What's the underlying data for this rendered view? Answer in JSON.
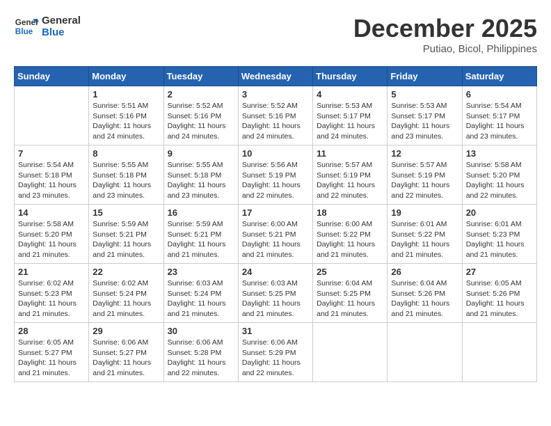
{
  "header": {
    "logo_general": "General",
    "logo_blue": "Blue",
    "month": "December 2025",
    "location": "Putiao, Bicol, Philippines"
  },
  "weekdays": [
    "Sunday",
    "Monday",
    "Tuesday",
    "Wednesday",
    "Thursday",
    "Friday",
    "Saturday"
  ],
  "weeks": [
    [
      {
        "day": "",
        "info": ""
      },
      {
        "day": "1",
        "info": "Sunrise: 5:51 AM\nSunset: 5:16 PM\nDaylight: 11 hours\nand 24 minutes."
      },
      {
        "day": "2",
        "info": "Sunrise: 5:52 AM\nSunset: 5:16 PM\nDaylight: 11 hours\nand 24 minutes."
      },
      {
        "day": "3",
        "info": "Sunrise: 5:52 AM\nSunset: 5:16 PM\nDaylight: 11 hours\nand 24 minutes."
      },
      {
        "day": "4",
        "info": "Sunrise: 5:53 AM\nSunset: 5:17 PM\nDaylight: 11 hours\nand 24 minutes."
      },
      {
        "day": "5",
        "info": "Sunrise: 5:53 AM\nSunset: 5:17 PM\nDaylight: 11 hours\nand 23 minutes."
      },
      {
        "day": "6",
        "info": "Sunrise: 5:54 AM\nSunset: 5:17 PM\nDaylight: 11 hours\nand 23 minutes."
      }
    ],
    [
      {
        "day": "7",
        "info": "Sunrise: 5:54 AM\nSunset: 5:18 PM\nDaylight: 11 hours\nand 23 minutes."
      },
      {
        "day": "8",
        "info": "Sunrise: 5:55 AM\nSunset: 5:18 PM\nDaylight: 11 hours\nand 23 minutes."
      },
      {
        "day": "9",
        "info": "Sunrise: 5:55 AM\nSunset: 5:18 PM\nDaylight: 11 hours\nand 23 minutes."
      },
      {
        "day": "10",
        "info": "Sunrise: 5:56 AM\nSunset: 5:19 PM\nDaylight: 11 hours\nand 22 minutes."
      },
      {
        "day": "11",
        "info": "Sunrise: 5:57 AM\nSunset: 5:19 PM\nDaylight: 11 hours\nand 22 minutes."
      },
      {
        "day": "12",
        "info": "Sunrise: 5:57 AM\nSunset: 5:19 PM\nDaylight: 11 hours\nand 22 minutes."
      },
      {
        "day": "13",
        "info": "Sunrise: 5:58 AM\nSunset: 5:20 PM\nDaylight: 11 hours\nand 22 minutes."
      }
    ],
    [
      {
        "day": "14",
        "info": "Sunrise: 5:58 AM\nSunset: 5:20 PM\nDaylight: 11 hours\nand 21 minutes."
      },
      {
        "day": "15",
        "info": "Sunrise: 5:59 AM\nSunset: 5:21 PM\nDaylight: 11 hours\nand 21 minutes."
      },
      {
        "day": "16",
        "info": "Sunrise: 5:59 AM\nSunset: 5:21 PM\nDaylight: 11 hours\nand 21 minutes."
      },
      {
        "day": "17",
        "info": "Sunrise: 6:00 AM\nSunset: 5:21 PM\nDaylight: 11 hours\nand 21 minutes."
      },
      {
        "day": "18",
        "info": "Sunrise: 6:00 AM\nSunset: 5:22 PM\nDaylight: 11 hours\nand 21 minutes."
      },
      {
        "day": "19",
        "info": "Sunrise: 6:01 AM\nSunset: 5:22 PM\nDaylight: 11 hours\nand 21 minutes."
      },
      {
        "day": "20",
        "info": "Sunrise: 6:01 AM\nSunset: 5:23 PM\nDaylight: 11 hours\nand 21 minutes."
      }
    ],
    [
      {
        "day": "21",
        "info": "Sunrise: 6:02 AM\nSunset: 5:23 PM\nDaylight: 11 hours\nand 21 minutes."
      },
      {
        "day": "22",
        "info": "Sunrise: 6:02 AM\nSunset: 5:24 PM\nDaylight: 11 hours\nand 21 minutes."
      },
      {
        "day": "23",
        "info": "Sunrise: 6:03 AM\nSunset: 5:24 PM\nDaylight: 11 hours\nand 21 minutes."
      },
      {
        "day": "24",
        "info": "Sunrise: 6:03 AM\nSunset: 5:25 PM\nDaylight: 11 hours\nand 21 minutes."
      },
      {
        "day": "25",
        "info": "Sunrise: 6:04 AM\nSunset: 5:25 PM\nDaylight: 11 hours\nand 21 minutes."
      },
      {
        "day": "26",
        "info": "Sunrise: 6:04 AM\nSunset: 5:26 PM\nDaylight: 11 hours\nand 21 minutes."
      },
      {
        "day": "27",
        "info": "Sunrise: 6:05 AM\nSunset: 5:26 PM\nDaylight: 11 hours\nand 21 minutes."
      }
    ],
    [
      {
        "day": "28",
        "info": "Sunrise: 6:05 AM\nSunset: 5:27 PM\nDaylight: 11 hours\nand 21 minutes."
      },
      {
        "day": "29",
        "info": "Sunrise: 6:06 AM\nSunset: 5:27 PM\nDaylight: 11 hours\nand 21 minutes."
      },
      {
        "day": "30",
        "info": "Sunrise: 6:06 AM\nSunset: 5:28 PM\nDaylight: 11 hours\nand 22 minutes."
      },
      {
        "day": "31",
        "info": "Sunrise: 6:06 AM\nSunset: 5:29 PM\nDaylight: 11 hours\nand 22 minutes."
      },
      {
        "day": "",
        "info": ""
      },
      {
        "day": "",
        "info": ""
      },
      {
        "day": "",
        "info": ""
      }
    ]
  ]
}
